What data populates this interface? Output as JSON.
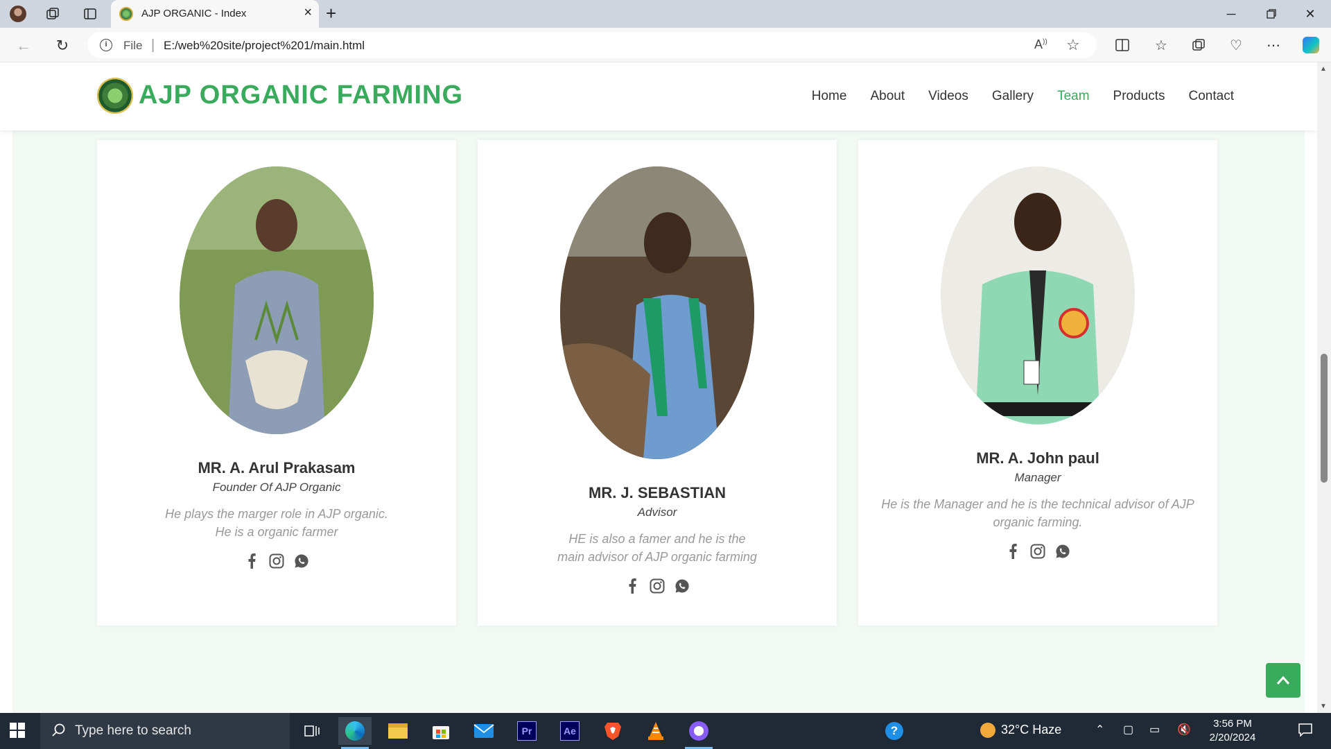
{
  "browser": {
    "tab_title": "AJP ORGANIC - Index",
    "address_scheme": "File",
    "address_url": "E:/web%20site/project%201/main.html"
  },
  "site": {
    "brand": "AJP ORGANIC FARMING",
    "nav": [
      {
        "label": "Home",
        "active": false
      },
      {
        "label": "About",
        "active": false
      },
      {
        "label": "Videos",
        "active": false
      },
      {
        "label": "Gallery",
        "active": false
      },
      {
        "label": "Team",
        "active": true
      },
      {
        "label": "Products",
        "active": false
      },
      {
        "label": "Contact",
        "active": false
      }
    ],
    "accent_color": "#3aaa5c"
  },
  "team": [
    {
      "name": "MR. A. Arul Prakasam",
      "role": "Founder Of AJP Organic",
      "desc_line1": "He plays the marger role in AJP organic.",
      "desc_line2": "He is a organic farmer"
    },
    {
      "name": "MR. J. SEBASTIAN",
      "role": "Advisor",
      "desc_line1": "HE is also a famer and he is the",
      "desc_line2": "main advisor of AJP organic farming"
    },
    {
      "name": "MR. A. John paul",
      "role": "Manager",
      "desc_line1": "He is the Manager and he is the technical advisor of AJP",
      "desc_line2": "organic farming."
    }
  ],
  "taskbar": {
    "search_placeholder": "Type here to search",
    "weather": "32°C  Haze",
    "time": "3:56 PM",
    "date": "2/20/2024"
  }
}
